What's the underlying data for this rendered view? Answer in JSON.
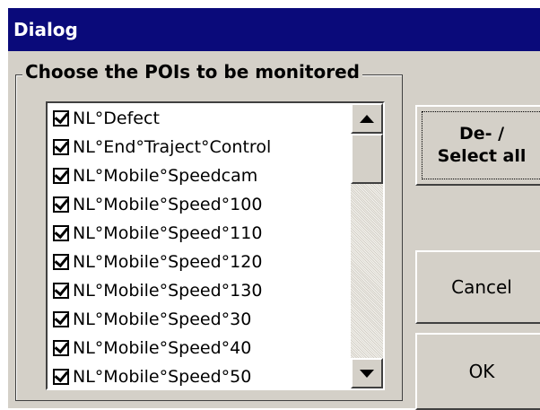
{
  "window": {
    "title": "Dialog"
  },
  "group": {
    "title": "Choose the POIs to be monitored"
  },
  "poi_list": {
    "items": [
      {
        "label": "NL°Defect",
        "checked": true
      },
      {
        "label": "NL°End°Traject°Control",
        "checked": true
      },
      {
        "label": "NL°Mobile°Speedcam",
        "checked": true
      },
      {
        "label": "NL°Mobile°Speed°100",
        "checked": true
      },
      {
        "label": "NL°Mobile°Speed°110",
        "checked": true
      },
      {
        "label": "NL°Mobile°Speed°120",
        "checked": true
      },
      {
        "label": "NL°Mobile°Speed°130",
        "checked": true
      },
      {
        "label": "NL°Mobile°Speed°30",
        "checked": true
      },
      {
        "label": "NL°Mobile°Speed°40",
        "checked": true
      },
      {
        "label": "NL°Mobile°Speed°50",
        "checked": true
      }
    ]
  },
  "buttons": {
    "select_all": "De- /\nSelect all",
    "cancel": "Cancel",
    "ok": "OK"
  }
}
